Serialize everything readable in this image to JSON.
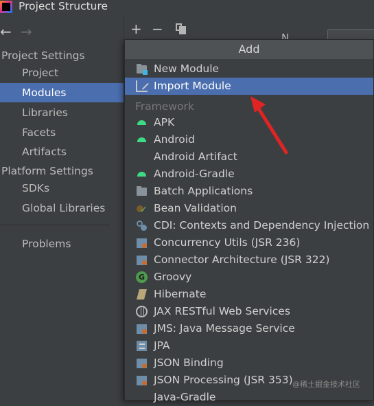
{
  "window": {
    "title": "Project Structure"
  },
  "sidebar": {
    "project_settings_header": "Project Settings",
    "project_items": [
      "Project",
      "Modules",
      "Libraries",
      "Facets",
      "Artifacts"
    ],
    "selected_item": "Modules",
    "platform_settings_header": "Platform Settings",
    "platform_items": [
      "SDKs",
      "Global Libraries"
    ],
    "problems": "Problems"
  },
  "toolbar": {
    "add_glyph": "+",
    "remove_glyph": "−"
  },
  "background_panel": {
    "label_fragment": "N"
  },
  "popup": {
    "header": "Add",
    "actions": [
      {
        "label": "New Module",
        "icon": "module-folder-icon"
      },
      {
        "label": "Import Module",
        "icon": "import-icon",
        "selected": true
      }
    ],
    "framework_header": "Framework",
    "frameworks": [
      {
        "label": "APK",
        "icon": "android-icon"
      },
      {
        "label": "Android",
        "icon": "android-icon"
      },
      {
        "label": "Android Artifact",
        "icon": "none"
      },
      {
        "label": "Android-Gradle",
        "icon": "android-icon"
      },
      {
        "label": "Batch Applications",
        "icon": "folder-icon"
      },
      {
        "label": "Bean Validation",
        "icon": "bean-validation-icon"
      },
      {
        "label": "CDI: Contexts and Dependency Injection",
        "icon": "cdi-icon"
      },
      {
        "label": "Concurrency Utils (JSR 236)",
        "icon": "javaee-icon"
      },
      {
        "label": "Connector Architecture (JSR 322)",
        "icon": "javaee-icon"
      },
      {
        "label": "Groovy",
        "icon": "groovy-icon",
        "glyph": "G"
      },
      {
        "label": "Hibernate",
        "icon": "hibernate-icon"
      },
      {
        "label": "JAX RESTful Web Services",
        "icon": "globe-icon"
      },
      {
        "label": "JMS: Java Message Service",
        "icon": "javaee-icon"
      },
      {
        "label": "JPA",
        "icon": "jpa-icon"
      },
      {
        "label": "JSON Binding",
        "icon": "javaee-icon"
      },
      {
        "label": "JSON Processing (JSR 353)",
        "icon": "javaee-icon"
      },
      {
        "label": "Java-Gradle",
        "icon": "none"
      }
    ]
  },
  "watermark": "@稀土掘金技术社区",
  "colors": {
    "selection": "#4b6eaf",
    "annotation_arrow": "#e02424",
    "android_green": "#3ddc84"
  }
}
